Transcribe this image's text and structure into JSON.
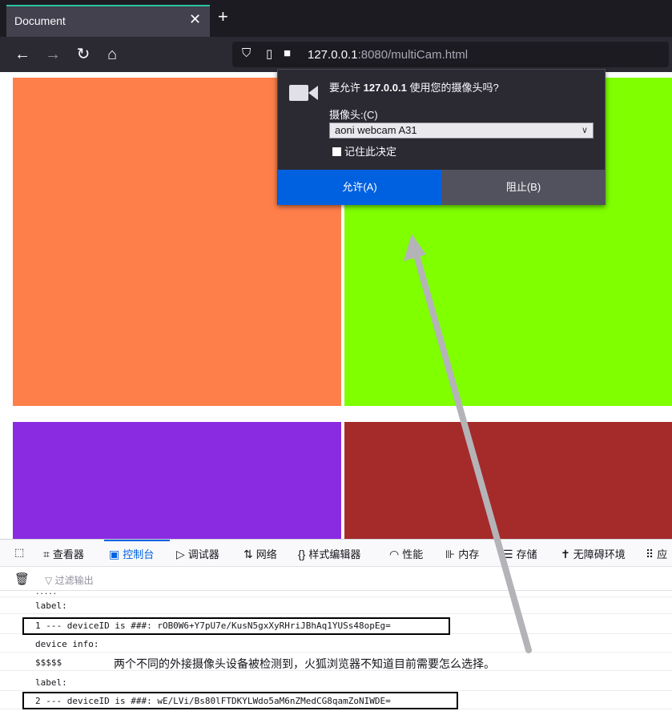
{
  "browser": {
    "tab_title": "Document",
    "tab_close": "✕",
    "new_tab": "+",
    "url_host": "127.0.0.1",
    "url_rest": ":8080/multiCam.html"
  },
  "page": {
    "boxes": [
      {
        "name": "orange-video-box",
        "color": "#ff7f4a"
      },
      {
        "name": "green-video-box",
        "color": "#7fff00"
      },
      {
        "name": "purple-video-box",
        "color": "#8a2be2"
      },
      {
        "name": "red-video-box",
        "color": "#a52a2a"
      }
    ]
  },
  "permission_popup": {
    "message_prefix": "要允许 ",
    "message_host": "127.0.0.1",
    "message_suffix": " 使用您的摄像头吗?",
    "camera_label": "摄像头:(C)",
    "selected_camera": "aoni webcam A31",
    "remember_label": "记住此决定",
    "allow_label": "允许(A)",
    "block_label": "阻止(B)"
  },
  "devtools": {
    "tabs": [
      {
        "name": "tab-inspector",
        "label": "查看器",
        "icon": "⌗"
      },
      {
        "name": "tab-console",
        "label": "控制台",
        "icon": "▣"
      },
      {
        "name": "tab-debugger",
        "label": "调试器",
        "icon": "▷"
      },
      {
        "name": "tab-network",
        "label": "网络",
        "icon": "⇅"
      },
      {
        "name": "tab-style-editor",
        "label": "样式编辑器",
        "icon": "{}"
      },
      {
        "name": "tab-performance",
        "label": "性能",
        "icon": "◠"
      },
      {
        "name": "tab-memory",
        "label": "内存",
        "icon": "⊪"
      },
      {
        "name": "tab-storage",
        "label": "存储",
        "icon": "☰"
      },
      {
        "name": "tab-accessibility",
        "label": "无障碍环境",
        "icon": "✝"
      },
      {
        "name": "tab-application",
        "label": "应",
        "icon": "⠿"
      }
    ],
    "filter_placeholder": "过滤输出",
    "console_lines": [
      ".....",
      "label:",
      "1 --- deviceID is ###: rOB0W6+Y7pU7e/KusN5gxXyRHriJBhAq1YUSs48opEg=",
      "device info:",
      "$$$$$",
      "label:",
      "2 --- deviceID is ###: wE/LVi/Bs80lFTDKYLWdo5aM6nZMedCG8qamZoNIWDE="
    ],
    "annotation": "两个不同的外接摄像头设备被检测到，火狐浏览器不知道目前需要怎么选择。"
  }
}
